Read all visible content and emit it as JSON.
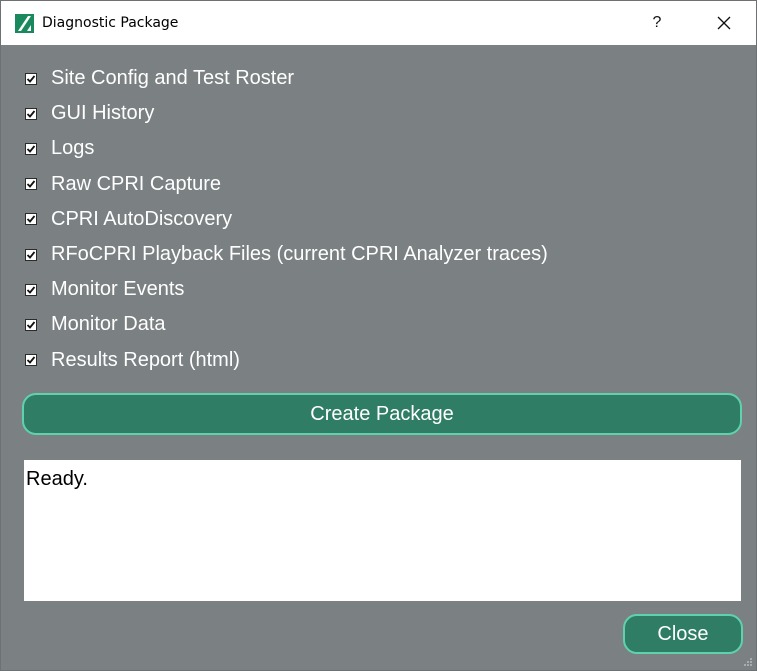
{
  "window": {
    "title": "Diagnostic Package",
    "help_label": "?"
  },
  "options": [
    {
      "label": "Site Config and Test Roster",
      "checked": true
    },
    {
      "label": "GUI History",
      "checked": true
    },
    {
      "label": "Logs",
      "checked": true
    },
    {
      "label": "Raw CPRI Capture",
      "checked": true
    },
    {
      "label": "CPRI AutoDiscovery",
      "checked": true
    },
    {
      "label": "RFoCPRI Playback Files (current CPRI Analyzer traces)",
      "checked": true
    },
    {
      "label": "Monitor Events",
      "checked": true
    },
    {
      "label": "Monitor Data",
      "checked": true
    },
    {
      "label": "Results Report (html)",
      "checked": true
    }
  ],
  "actions": {
    "create_label": "Create Package",
    "close_label": "Close"
  },
  "status": {
    "text": "Ready."
  },
  "colors": {
    "background": "#7b8082",
    "button_fill": "#2e7d64",
    "button_border": "#5fd2ad",
    "app_icon": "#1a8a5e"
  },
  "icons": {
    "app": "app-logo-icon",
    "close": "close-icon",
    "check": "checkmark-icon",
    "grip": "resize-grip-icon"
  }
}
